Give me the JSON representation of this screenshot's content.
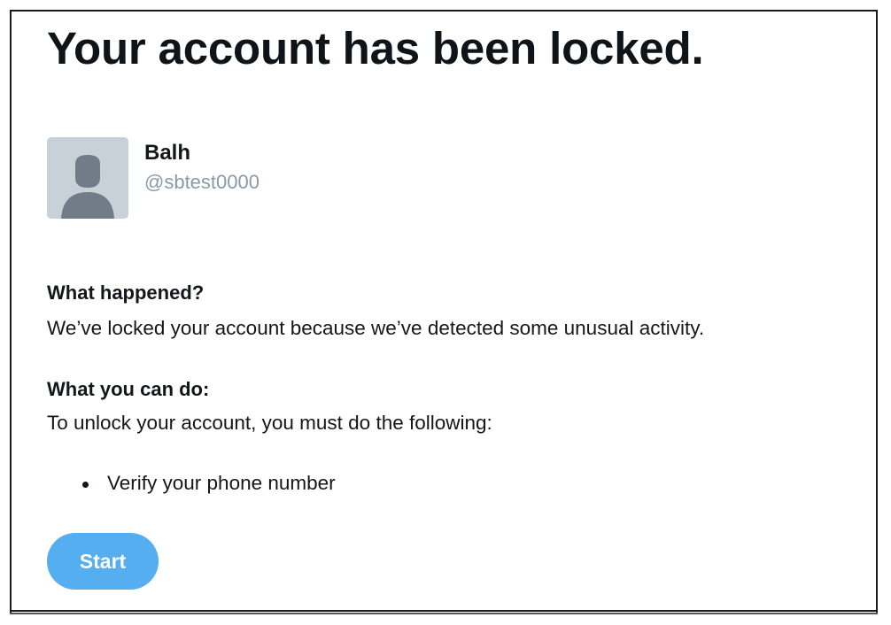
{
  "page": {
    "title": "Your account has been locked."
  },
  "account": {
    "display_name": "Balh",
    "handle": "@sbtest0000",
    "avatar_icon": "default-profile-avatar-icon"
  },
  "sections": {
    "what_happened": {
      "heading": "What happened?",
      "body": "We’ve locked your account because we’ve detected some unusual activity."
    },
    "what_you_can_do": {
      "heading": "What you can do:",
      "body": "To unlock your account, you must do the following:",
      "steps": [
        "Verify your phone number"
      ]
    }
  },
  "actions": {
    "start_label": "Start"
  },
  "colors": {
    "button_background": "#55aef0",
    "button_text": "#ffffff",
    "handle_text": "#8a99a6",
    "avatar_background": "#c8d0d8",
    "avatar_silhouette": "#707d89"
  }
}
